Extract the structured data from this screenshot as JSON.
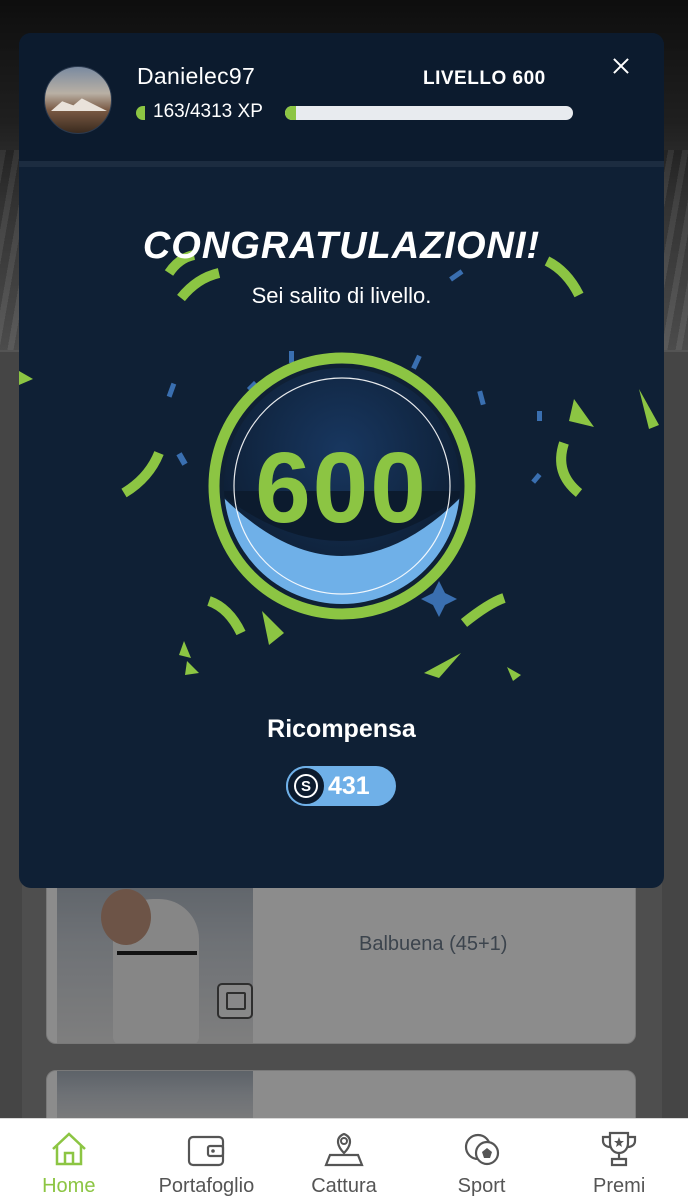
{
  "user": {
    "name": "Danielec97",
    "xp_text": "163/4313 XP",
    "xp_progress": 0.038,
    "level_label": "LIVELLO 600"
  },
  "modal": {
    "title": "CONGRATULAZIONI!",
    "subtitle": "Sei salito di livello.",
    "level": "600",
    "reward_label": "Ricompensa",
    "reward_value": "431"
  },
  "background": {
    "card_title": "Balbuena (45+1)"
  },
  "tabs": [
    {
      "label": "Home",
      "icon": "home-icon",
      "active": true
    },
    {
      "label": "Portafoglio",
      "icon": "wallet-icon",
      "active": false
    },
    {
      "label": "Cattura",
      "icon": "map-pin-icon",
      "active": false
    },
    {
      "label": "Sport",
      "icon": "sports-ball-icon",
      "active": false
    },
    {
      "label": "Premi",
      "icon": "trophy-icon",
      "active": false
    }
  ],
  "colors": {
    "accent_green": "#8cc543",
    "modal_bg": "#0f2035",
    "light_blue": "#6fb0e8"
  }
}
